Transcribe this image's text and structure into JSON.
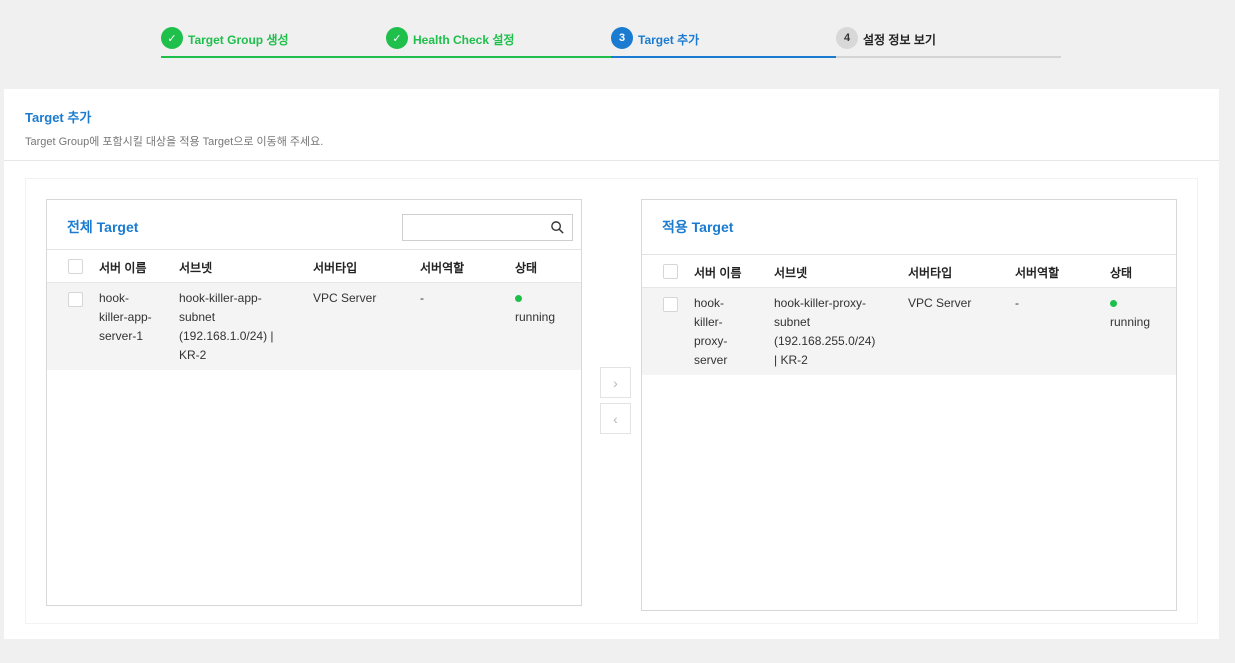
{
  "stepper": {
    "steps": [
      {
        "num": "✓",
        "label": "Target Group 생성",
        "state": "done"
      },
      {
        "num": "✓",
        "label": "Health Check 설정",
        "state": "done"
      },
      {
        "num": "3",
        "label": "Target 추가",
        "state": "active"
      },
      {
        "num": "4",
        "label": "설정 정보 보기",
        "state": "todo"
      }
    ]
  },
  "card": {
    "title": "Target 추가",
    "desc": "Target Group에 포함시킬 대상을 적용 Target으로 이동해 주세요."
  },
  "left_panel": {
    "title": "전체 Target",
    "search_placeholder": "",
    "headers": {
      "name": "서버 이름",
      "subnet": "서브넷",
      "type": "서버타입",
      "role": "서버역할",
      "status": "상태"
    },
    "rows": [
      {
        "name_lines": [
          "hook-",
          "killer-app-",
          "server-1"
        ],
        "subnet_lines": [
          "hook-killer-app-",
          "subnet",
          "(192.168.1.0/24) |",
          "KR-2"
        ],
        "type": "VPC Server",
        "role": "-",
        "status": "running"
      }
    ]
  },
  "right_panel": {
    "title": "적용 Target",
    "headers": {
      "name": "서버 이름",
      "subnet": "서브넷",
      "type": "서버타입",
      "role": "서버역할",
      "status": "상태"
    },
    "rows": [
      {
        "name_lines": [
          "hook-",
          "killer-",
          "proxy-",
          "server"
        ],
        "subnet_lines": [
          "hook-killer-proxy-",
          "subnet",
          "(192.168.255.0/24)",
          "| KR-2"
        ],
        "type": "VPC Server",
        "role": "-",
        "status": "running"
      }
    ]
  },
  "move_buttons": {
    "add": "›",
    "remove": "‹"
  },
  "colors": {
    "done": "#1fbf4c",
    "active": "#1a7bd0",
    "running": "#1fbf4c"
  }
}
